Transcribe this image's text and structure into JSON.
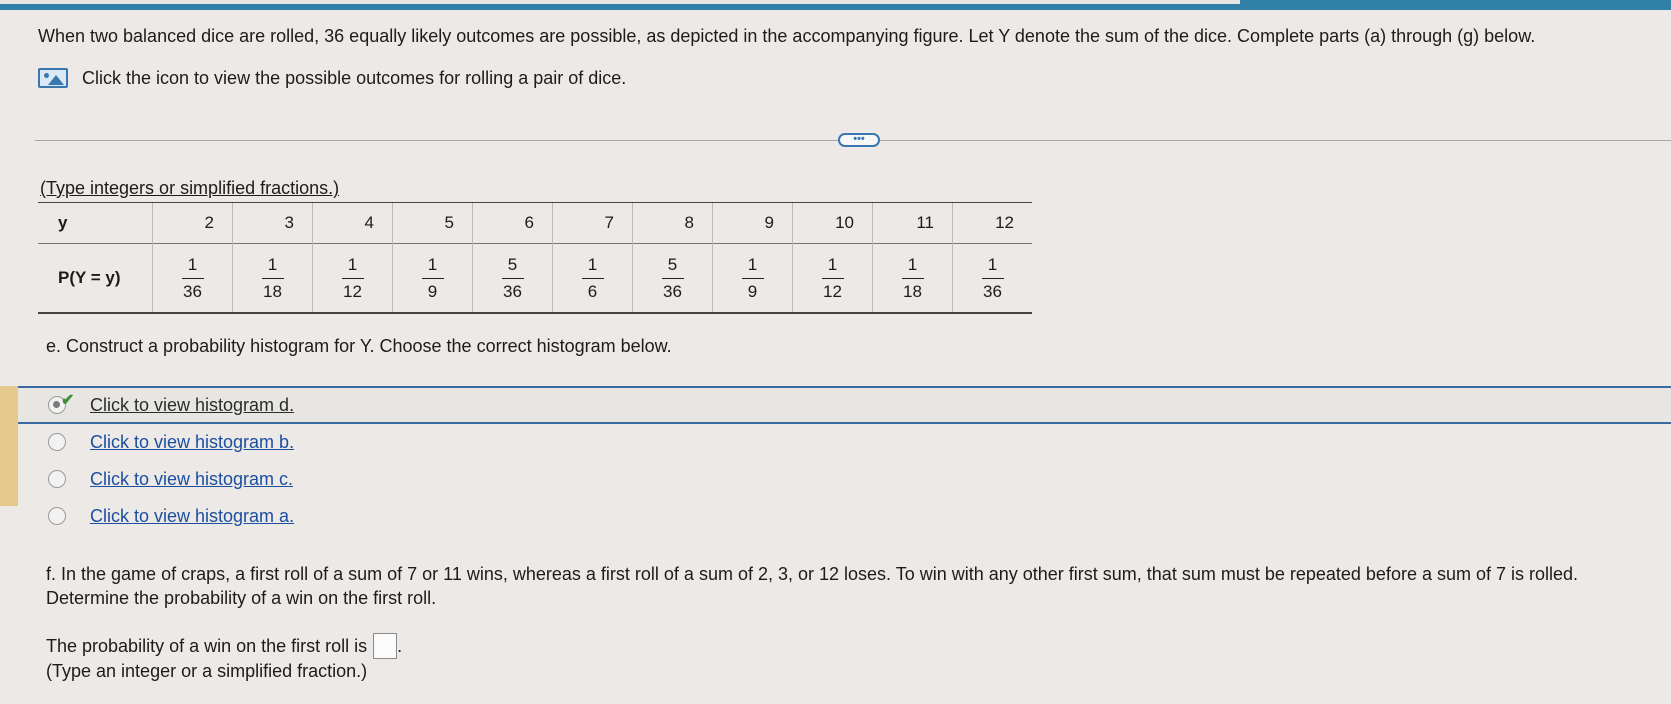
{
  "intro": "When two balanced dice are rolled, 36 equally likely outcomes are possible, as depicted in the accompanying figure. Let Y denote the sum of the dice. Complete parts (a) through (g) below.",
  "view_outcomes": "Click the icon to view the possible outcomes for rolling a pair of dice.",
  "more_label": "•••",
  "instruction": "(Type integers or simplified fractions.)",
  "table": {
    "y_header": "y",
    "p_header": "P(Y = y)",
    "y_values": [
      "2",
      "3",
      "4",
      "5",
      "6",
      "7",
      "8",
      "9",
      "10",
      "11",
      "12"
    ],
    "p_values": [
      {
        "num": "1",
        "den": "36"
      },
      {
        "num": "1",
        "den": "18"
      },
      {
        "num": "1",
        "den": "12"
      },
      {
        "num": "1",
        "den": "9"
      },
      {
        "num": "5",
        "den": "36"
      },
      {
        "num": "1",
        "den": "6"
      },
      {
        "num": "5",
        "den": "36"
      },
      {
        "num": "1",
        "den": "9"
      },
      {
        "num": "1",
        "den": "12"
      },
      {
        "num": "1",
        "den": "18"
      },
      {
        "num": "1",
        "den": "36"
      }
    ]
  },
  "part_e": "e. Construct a probability histogram for Y. Choose the correct histogram below.",
  "options": [
    {
      "label": "Click to view histogram d.",
      "selected": true
    },
    {
      "label": "Click to view histogram b.",
      "selected": false
    },
    {
      "label": "Click to view histogram c.",
      "selected": false
    },
    {
      "label": "Click to view histogram a.",
      "selected": false
    }
  ],
  "part_f": "f. In the game of craps, a first roll of a sum of 7 or 11 wins, whereas a first roll of a sum of 2, 3, or 12 loses. To win with any other first sum, that sum must be repeated before a sum of 7 is rolled. Determine the probability of a win on the first roll.",
  "answer_prompt": "The probability of a win on the first roll is",
  "answer_value": "",
  "answer_hint": "(Type an integer or a simplified fraction.)"
}
